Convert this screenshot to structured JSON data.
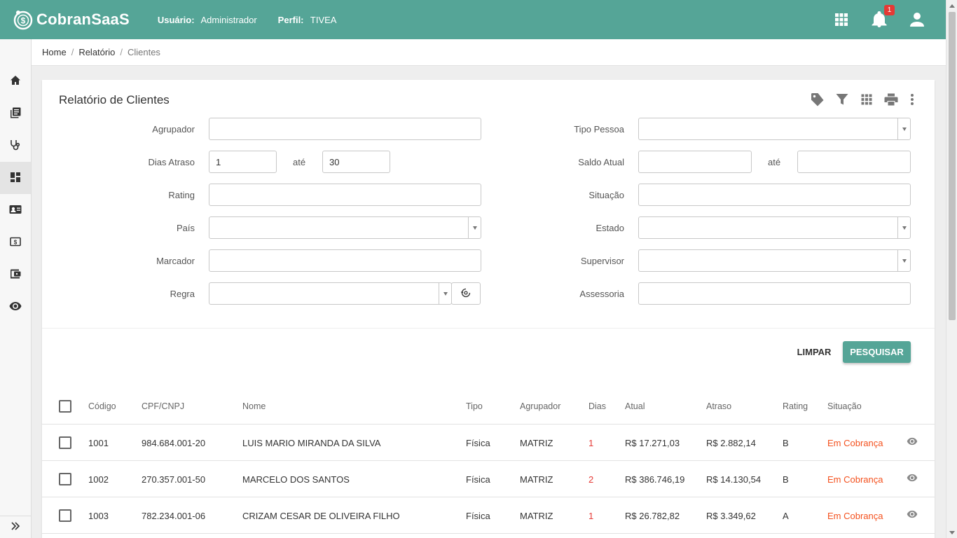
{
  "app": {
    "brand": "CobranSaaS"
  },
  "header": {
    "user_label": "Usuário:",
    "user_value": "Administrador",
    "profile_label": "Perfil:",
    "profile_value": "TIVEA",
    "notifications_count": "1"
  },
  "sidebar": {
    "items": [
      {
        "icon": "home-icon"
      },
      {
        "icon": "library-books-icon"
      },
      {
        "icon": "stethoscope-icon"
      },
      {
        "icon": "dashboard-icon",
        "active": true
      },
      {
        "icon": "contact-card-icon"
      },
      {
        "icon": "money-icon"
      },
      {
        "icon": "wallet-icon"
      },
      {
        "icon": "eye-icon"
      }
    ]
  },
  "breadcrumb": {
    "home": "Home",
    "report": "Relatório",
    "current": "Clientes"
  },
  "card": {
    "title": "Relatório de Clientes"
  },
  "filters": {
    "agrupador": {
      "label": "Agrupador",
      "value": ""
    },
    "dias_atraso": {
      "label": "Dias Atraso",
      "from": "1",
      "to_label": "até",
      "to": "30"
    },
    "rating": {
      "label": "Rating",
      "value": ""
    },
    "pais": {
      "label": "País",
      "value": ""
    },
    "marcador": {
      "label": "Marcador",
      "value": ""
    },
    "regra": {
      "label": "Regra",
      "value": ""
    },
    "tipo_pessoa": {
      "label": "Tipo Pessoa",
      "value": ""
    },
    "saldo_atual": {
      "label": "Saldo Atual",
      "from": "",
      "to_label": "até",
      "to": ""
    },
    "situacao": {
      "label": "Situação",
      "value": ""
    },
    "estado": {
      "label": "Estado",
      "value": ""
    },
    "supervisor": {
      "label": "Supervisor",
      "value": ""
    },
    "assessoria": {
      "label": "Assessoria",
      "value": ""
    }
  },
  "actions": {
    "clear": "LIMPAR",
    "search": "PESQUISAR"
  },
  "table": {
    "columns": [
      "Código",
      "CPF/CNPJ",
      "Nome",
      "Tipo",
      "Agrupador",
      "Dias",
      "Atual",
      "Atraso",
      "Rating",
      "Situação"
    ],
    "rows": [
      {
        "codigo": "1001",
        "cpf": "984.684.001-20",
        "nome": "LUIS MARIO MIRANDA DA SILVA",
        "tipo": "Física",
        "agrupador": "MATRIZ",
        "dias": "1",
        "atual": "R$ 17.271,03",
        "atraso": "R$ 2.882,14",
        "rating": "B",
        "situacao": "Em Cobrança"
      },
      {
        "codigo": "1002",
        "cpf": "270.357.001-50",
        "nome": "MARCELO DOS SANTOS",
        "tipo": "Física",
        "agrupador": "MATRIZ",
        "dias": "2",
        "atual": "R$ 386.746,19",
        "atraso": "R$ 14.130,54",
        "rating": "B",
        "situacao": "Em Cobrança"
      },
      {
        "codigo": "1003",
        "cpf": "782.234.001-06",
        "nome": "CRIZAM CESAR DE OLIVEIRA FILHO",
        "tipo": "Física",
        "agrupador": "MATRIZ",
        "dias": "1",
        "atual": "R$ 26.782,82",
        "atraso": "R$ 3.349,62",
        "rating": "A",
        "situacao": "Em Cobrança"
      }
    ]
  },
  "colors": {
    "primary": "#55a597",
    "danger": "#e53935",
    "status": "#f4511e"
  }
}
